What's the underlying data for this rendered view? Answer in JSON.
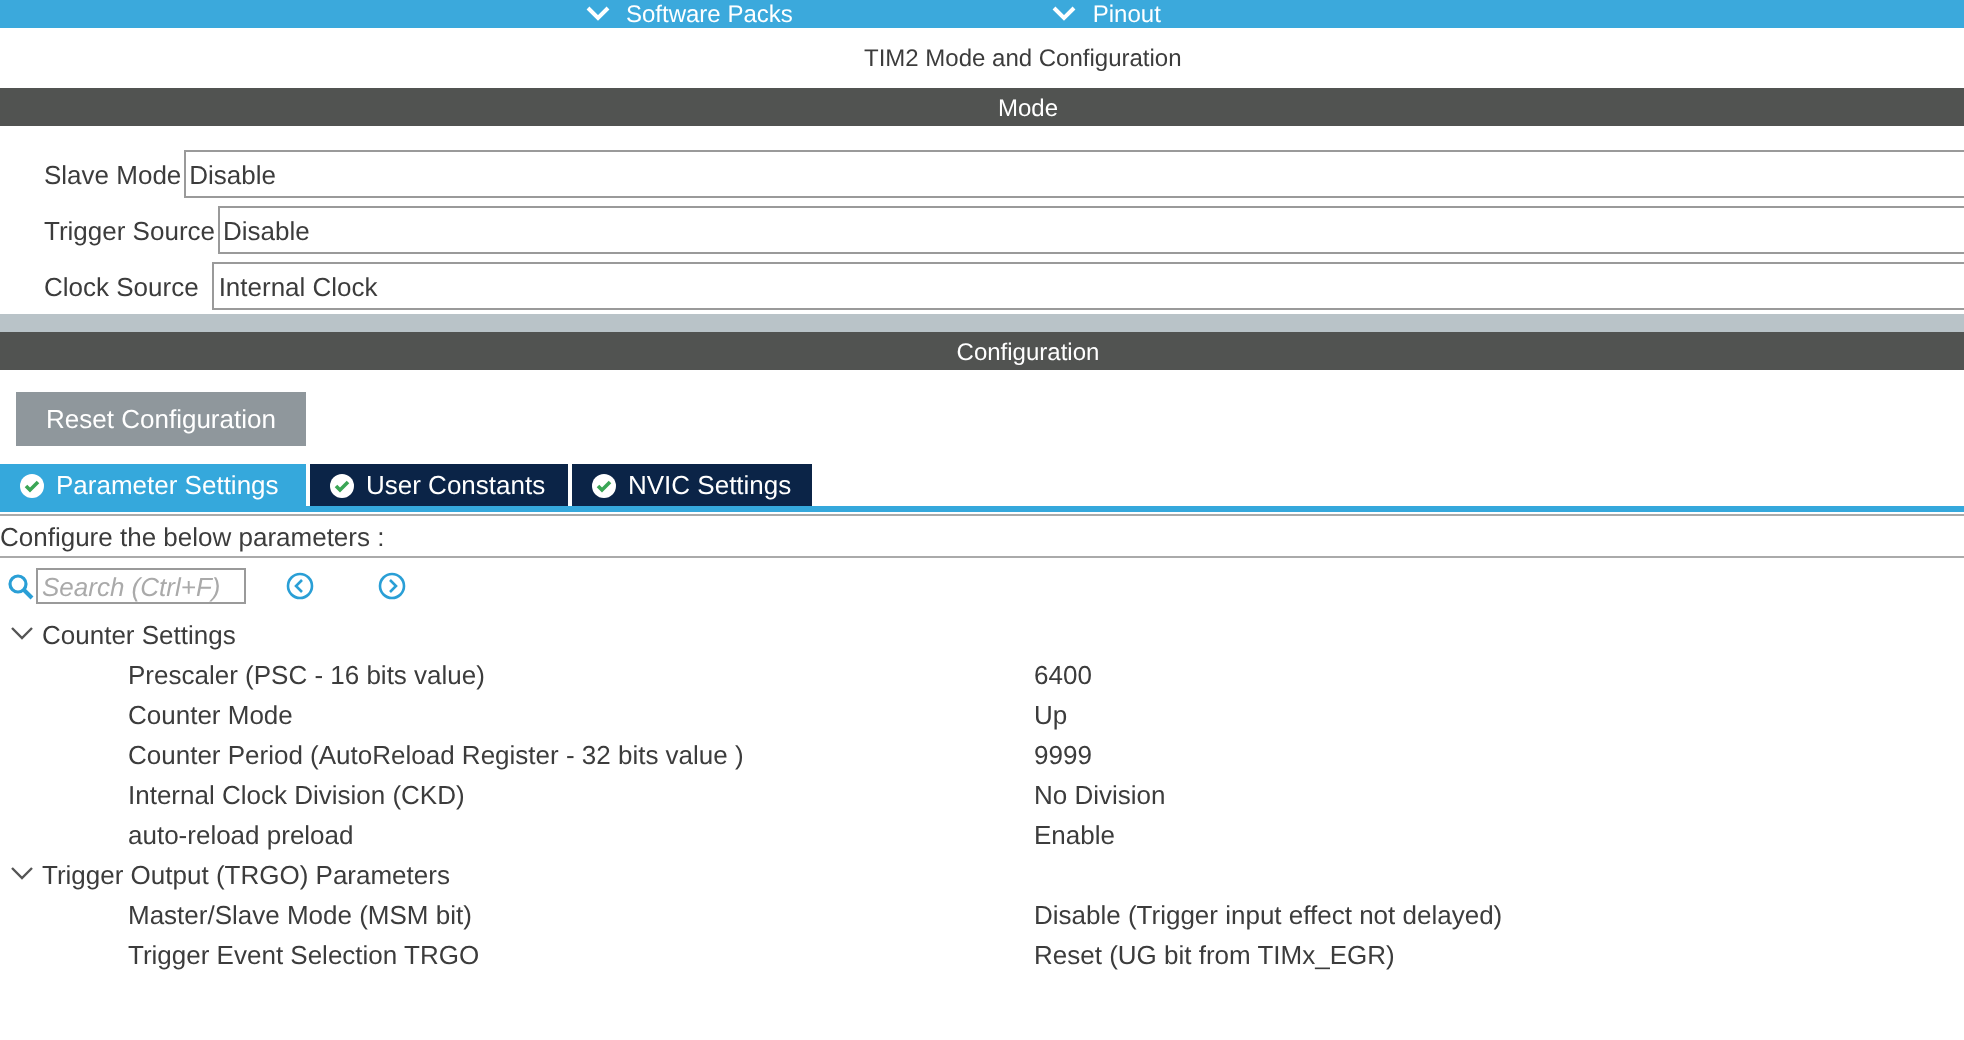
{
  "top_menu": [
    {
      "label": "Software Packs"
    },
    {
      "label": "Pinout"
    }
  ],
  "title": "TIM2 Mode and Configuration",
  "mode": {
    "header": "Mode",
    "fields": [
      {
        "label": "Slave Mode",
        "value": "Disable"
      },
      {
        "label": "Trigger Source",
        "value": "Disable"
      },
      {
        "label": "Clock Source",
        "value": "Internal Clock"
      }
    ]
  },
  "configuration": {
    "header": "Configuration",
    "reset_button": "Reset Configuration",
    "tabs": [
      {
        "label": "Parameter Settings",
        "selected": true
      },
      {
        "label": "User Constants",
        "selected": false
      },
      {
        "label": "NVIC Settings",
        "selected": false
      }
    ],
    "hint": "Configure the below parameters :",
    "search": {
      "placeholder": "Search (Ctrl+F)"
    },
    "tree": [
      {
        "label": "Counter Settings",
        "expanded": true,
        "children": [
          {
            "label": "Prescaler (PSC - 16 bits value)",
            "value": "6400"
          },
          {
            "label": "Counter Mode",
            "value": "Up"
          },
          {
            "label": "Counter Period (AutoReload Register - 32 bits value )",
            "value": "9999"
          },
          {
            "label": "Internal Clock Division (CKD)",
            "value": "No Division"
          },
          {
            "label": "auto-reload preload",
            "value": "Enable"
          }
        ]
      },
      {
        "label": "Trigger Output (TRGO) Parameters",
        "expanded": true,
        "children": [
          {
            "label": "Master/Slave Mode (MSM bit)",
            "value": "Disable (Trigger input effect not delayed)"
          },
          {
            "label": "Trigger Event Selection TRGO",
            "value": "Reset (UG bit from TIMx_EGR)"
          }
        ]
      }
    ]
  }
}
